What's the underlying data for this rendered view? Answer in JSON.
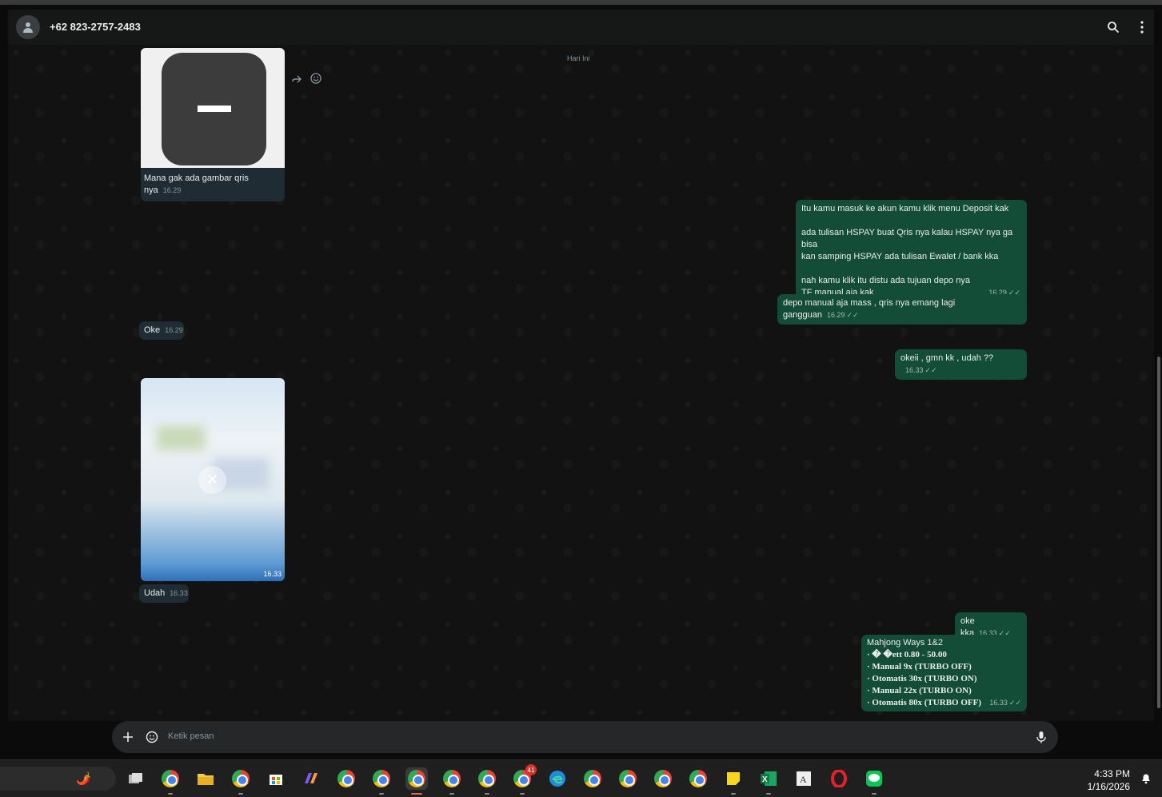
{
  "header": {
    "contact_name": "+62 823-2757-2483"
  },
  "chat": {
    "day_label": "Hari Ini",
    "messages": {
      "m1": {
        "text": "Mana gak ada gambar qris nya",
        "time": "16.29"
      },
      "m2": {
        "lines": [
          "Itu kamu masuk ke akun kamu klik menu Deposit kak",
          "",
          "ada tulisan HSPAY buat Qris nya kalau HSPAY nya ga bisa",
          "kan samping HSPAY ada tulisan Ewalet / bank kka",
          "",
          "nah kamu klik itu distu ada  tujuan depo nya",
          "TF manual aja kak"
        ],
        "time": "16.29"
      },
      "m3": {
        "text": "depo manual aja mass , qris nya emang lagi gangguan",
        "time": "16.29"
      },
      "m4": {
        "text": "Oke",
        "time": "16.29"
      },
      "m5": {
        "text": "okeii ,  gmn kk , udah ??",
        "time": "16.33"
      },
      "m6": {
        "image_time": "16.33"
      },
      "m7": {
        "text": "Udah",
        "time": "16.33"
      },
      "m8": {
        "text": "oke kka",
        "time": "16.33"
      },
      "m9": {
        "lines": [
          "Mahjong Ways 1&2",
          "· � �ett 0.80 - 50.00",
          "· Manual   9x (TURBO OFF)",
          "· Otomatis 30x (TURBO ON)",
          "· Manual   22x (TURBO ON)",
          "· Otomatis 80x (TURBO OFF)"
        ],
        "time": "16.33"
      }
    }
  },
  "compose": {
    "placeholder": "Ketik pesan"
  },
  "taskbar": {
    "clock_time": "4:33 PM",
    "clock_date": "1/16/2026",
    "badge_count": "41"
  },
  "colors": {
    "outgoing": "#144d37",
    "incoming": "#202c33",
    "background": "#121212"
  }
}
